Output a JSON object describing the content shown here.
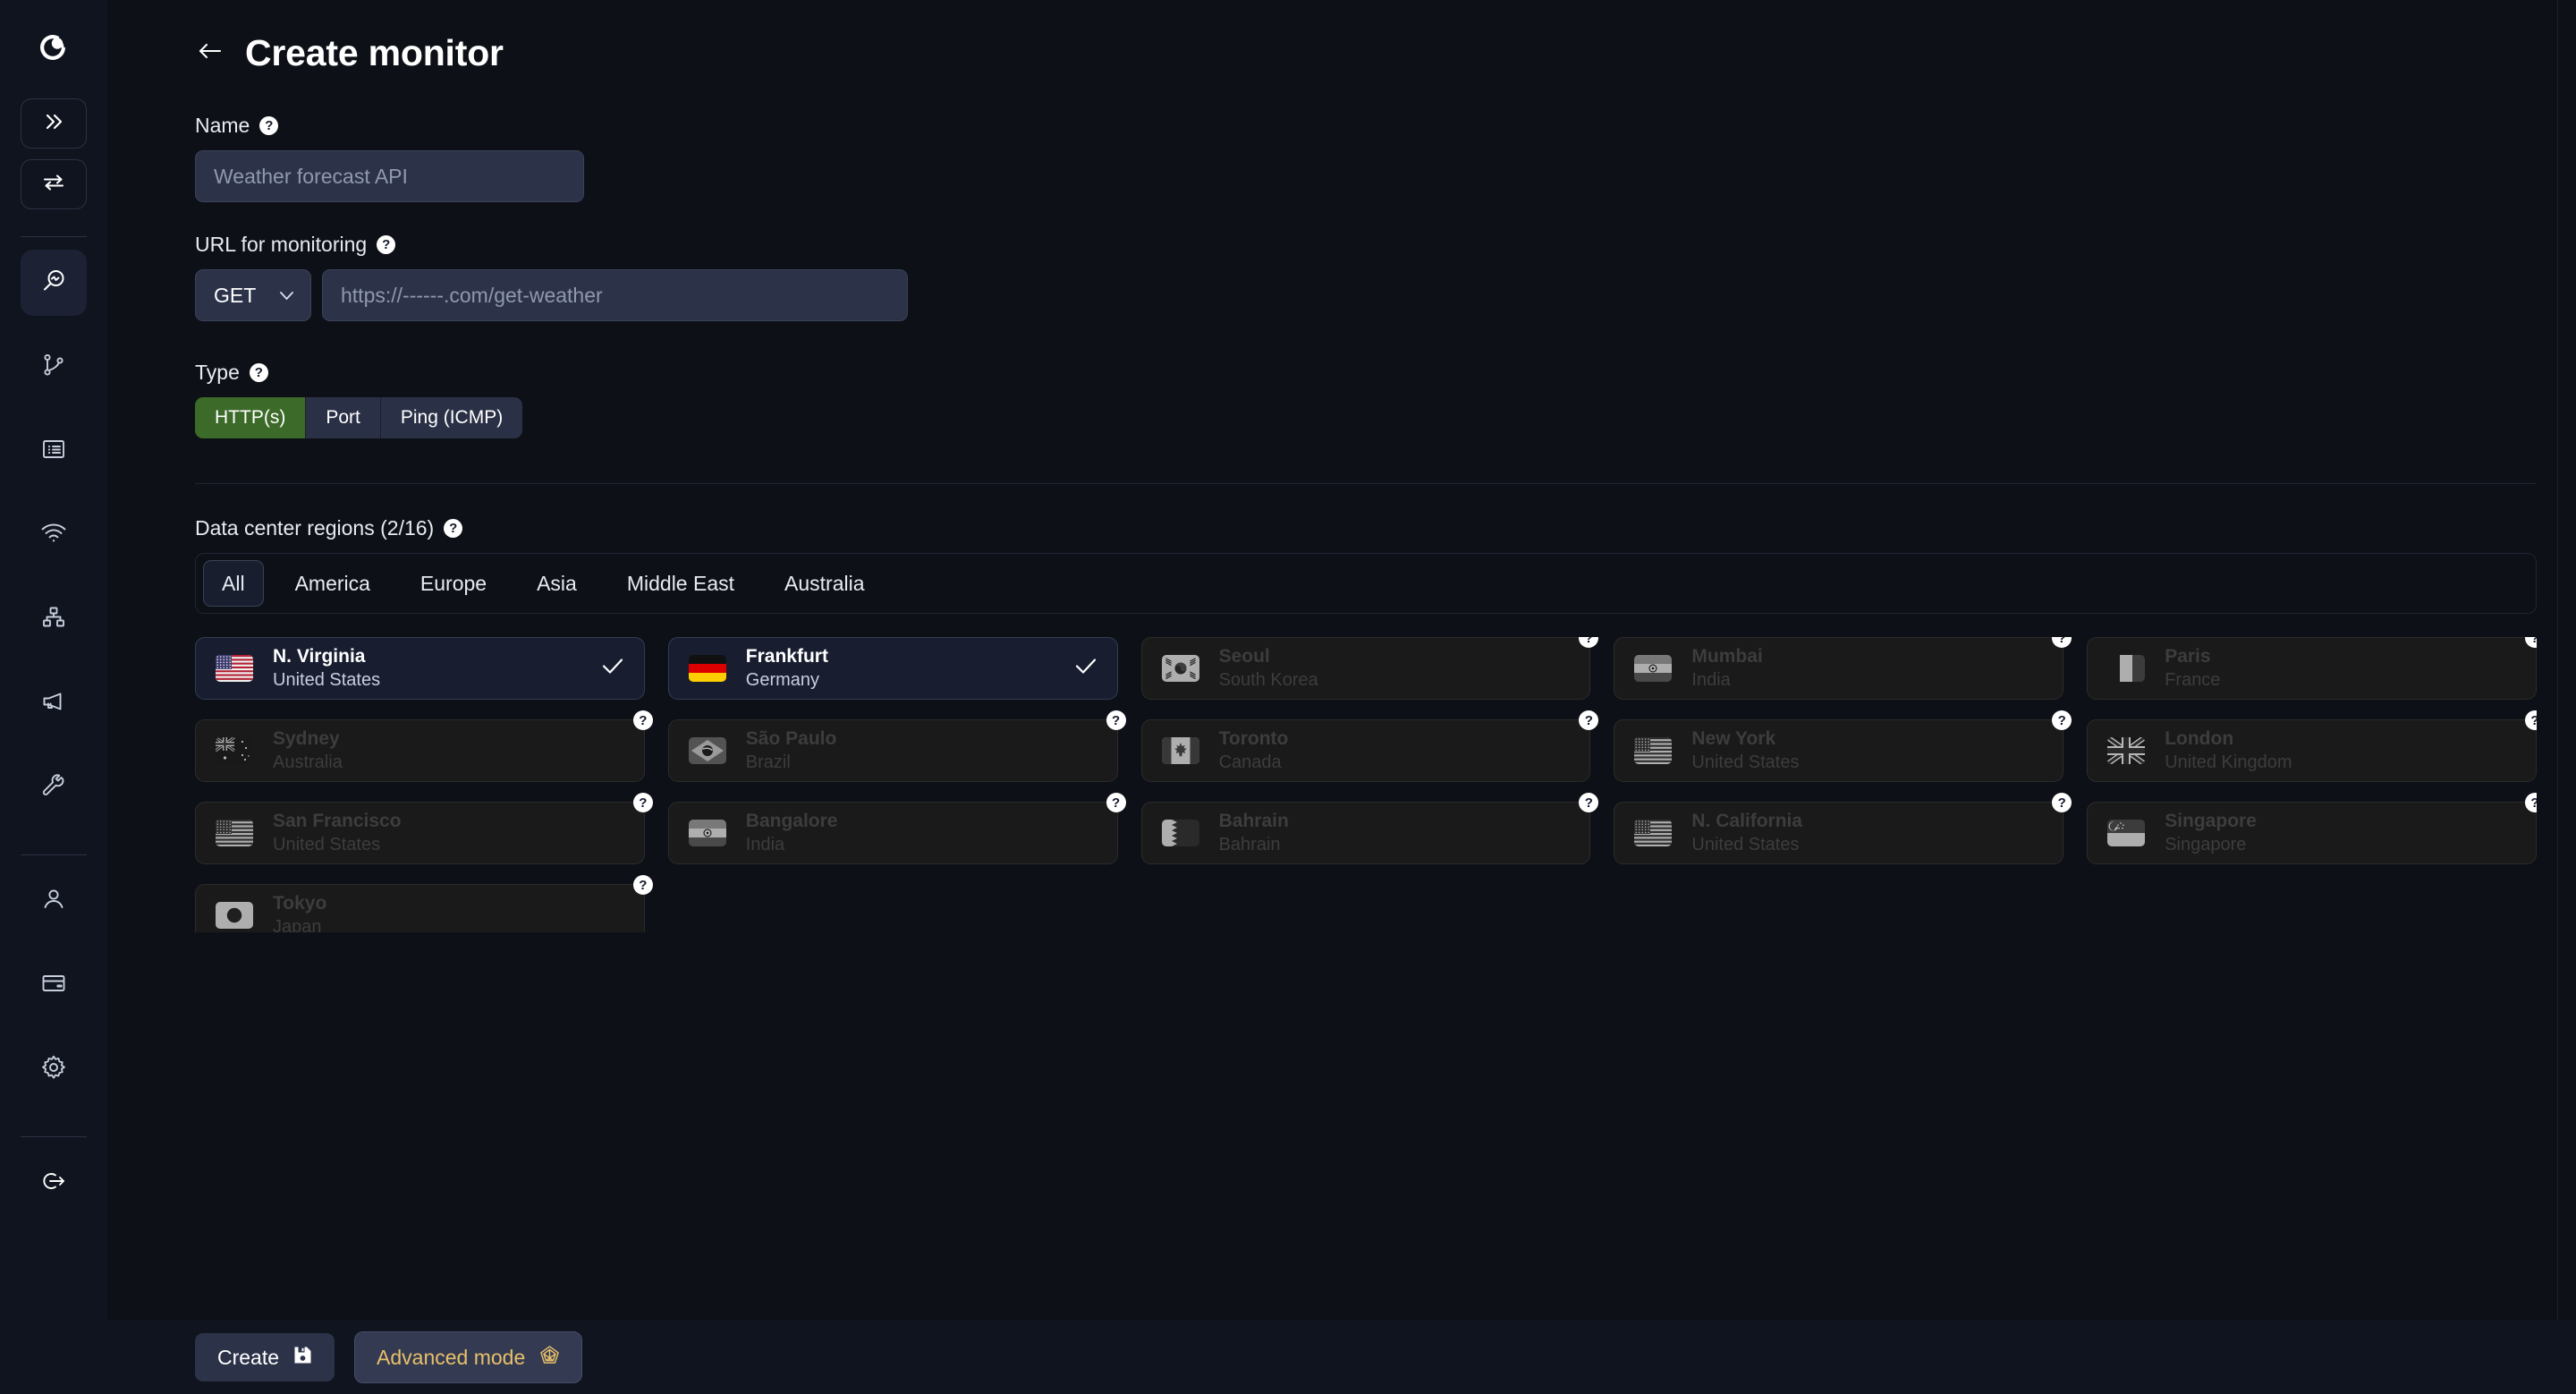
{
  "sidebar": {
    "logo": "brand-logo",
    "top_buttons": [
      {
        "name": "expand-sidebar-button",
        "icon": "double-chevron-right-icon"
      },
      {
        "name": "switch-account-button",
        "icon": "swap-arrows-icon"
      }
    ],
    "items": [
      {
        "name": "sidebar-item-monitors",
        "icon": "magnifier-pulse-icon",
        "active": true
      },
      {
        "name": "sidebar-item-workflows",
        "icon": "branch-icon",
        "active": false
      },
      {
        "name": "sidebar-item-reports",
        "icon": "list-panel-icon",
        "active": false
      },
      {
        "name": "sidebar-item-status",
        "icon": "wifi-icon",
        "active": false
      },
      {
        "name": "sidebar-item-network",
        "icon": "sitemap-icon",
        "active": false
      },
      {
        "name": "sidebar-item-announcements",
        "icon": "megaphone-icon",
        "active": false
      },
      {
        "name": "sidebar-item-tools",
        "icon": "wrench-icon",
        "active": false
      },
      {
        "name": "sidebar-item-profile",
        "icon": "user-icon",
        "active": false
      },
      {
        "name": "sidebar-item-billing",
        "icon": "credit-card-icon",
        "active": false
      },
      {
        "name": "sidebar-item-settings",
        "icon": "gear-icon",
        "active": false
      },
      {
        "name": "sidebar-item-logout",
        "icon": "logout-icon",
        "active": false
      }
    ]
  },
  "header": {
    "back_icon": "arrow-left-icon",
    "title": "Create monitor"
  },
  "form": {
    "name": {
      "label": "Name",
      "help_icon": "question-mark-icon",
      "value": "",
      "placeholder": "Weather forecast API"
    },
    "url": {
      "label": "URL for monitoring",
      "help_icon": "question-mark-icon",
      "method_value": "GET",
      "method_chevron": "chevron-down-icon",
      "value": "",
      "placeholder": "https://------.com/get-weather"
    },
    "type": {
      "label": "Type",
      "help_icon": "question-mark-icon",
      "options": [
        "HTTP(s)",
        "Port",
        "Ping (ICMP)"
      ],
      "selected": "HTTP(s)",
      "active_color": "#3c6a28"
    }
  },
  "regions": {
    "label": "Data center regions (2/16)",
    "help_icon": "question-mark-icon",
    "selected_count": 2,
    "total_count": 16,
    "tabs": [
      "All",
      "America",
      "Europe",
      "Asia",
      "Middle East",
      "Australia"
    ],
    "active_tab": "All",
    "check_icon": "check-icon",
    "locked_icon": "question-mark-icon",
    "items": [
      {
        "city": "N. Virginia",
        "country": "United States",
        "flag": "us",
        "state": "selected"
      },
      {
        "city": "Frankfurt",
        "country": "Germany",
        "flag": "de",
        "state": "selected"
      },
      {
        "city": "Seoul",
        "country": "South Korea",
        "flag": "kr",
        "state": "locked"
      },
      {
        "city": "Mumbai",
        "country": "India",
        "flag": "in",
        "state": "locked"
      },
      {
        "city": "Paris",
        "country": "France",
        "flag": "fr",
        "state": "locked"
      },
      {
        "city": "Sydney",
        "country": "Australia",
        "flag": "au",
        "state": "locked"
      },
      {
        "city": "São Paulo",
        "country": "Brazil",
        "flag": "br",
        "state": "locked"
      },
      {
        "city": "Toronto",
        "country": "Canada",
        "flag": "ca",
        "state": "locked"
      },
      {
        "city": "New York",
        "country": "United States",
        "flag": "us",
        "state": "locked"
      },
      {
        "city": "London",
        "country": "United Kingdom",
        "flag": "gb",
        "state": "locked"
      },
      {
        "city": "San Francisco",
        "country": "United States",
        "flag": "us",
        "state": "locked"
      },
      {
        "city": "Bangalore",
        "country": "India",
        "flag": "in",
        "state": "locked"
      },
      {
        "city": "Bahrain",
        "country": "Bahrain",
        "flag": "bh",
        "state": "locked"
      },
      {
        "city": "N. California",
        "country": "United States",
        "flag": "us",
        "state": "locked"
      },
      {
        "city": "Singapore",
        "country": "Singapore",
        "flag": "sg",
        "state": "locked"
      },
      {
        "city": "Tokyo",
        "country": "Japan",
        "flag": "jp",
        "state": "locked"
      }
    ]
  },
  "footer": {
    "create_label": "Create",
    "create_icon": "floppy-disk-icon",
    "advanced_label": "Advanced mode",
    "advanced_icon": "gem-pentagon-icon",
    "advanced_color": "#e8c06a"
  }
}
